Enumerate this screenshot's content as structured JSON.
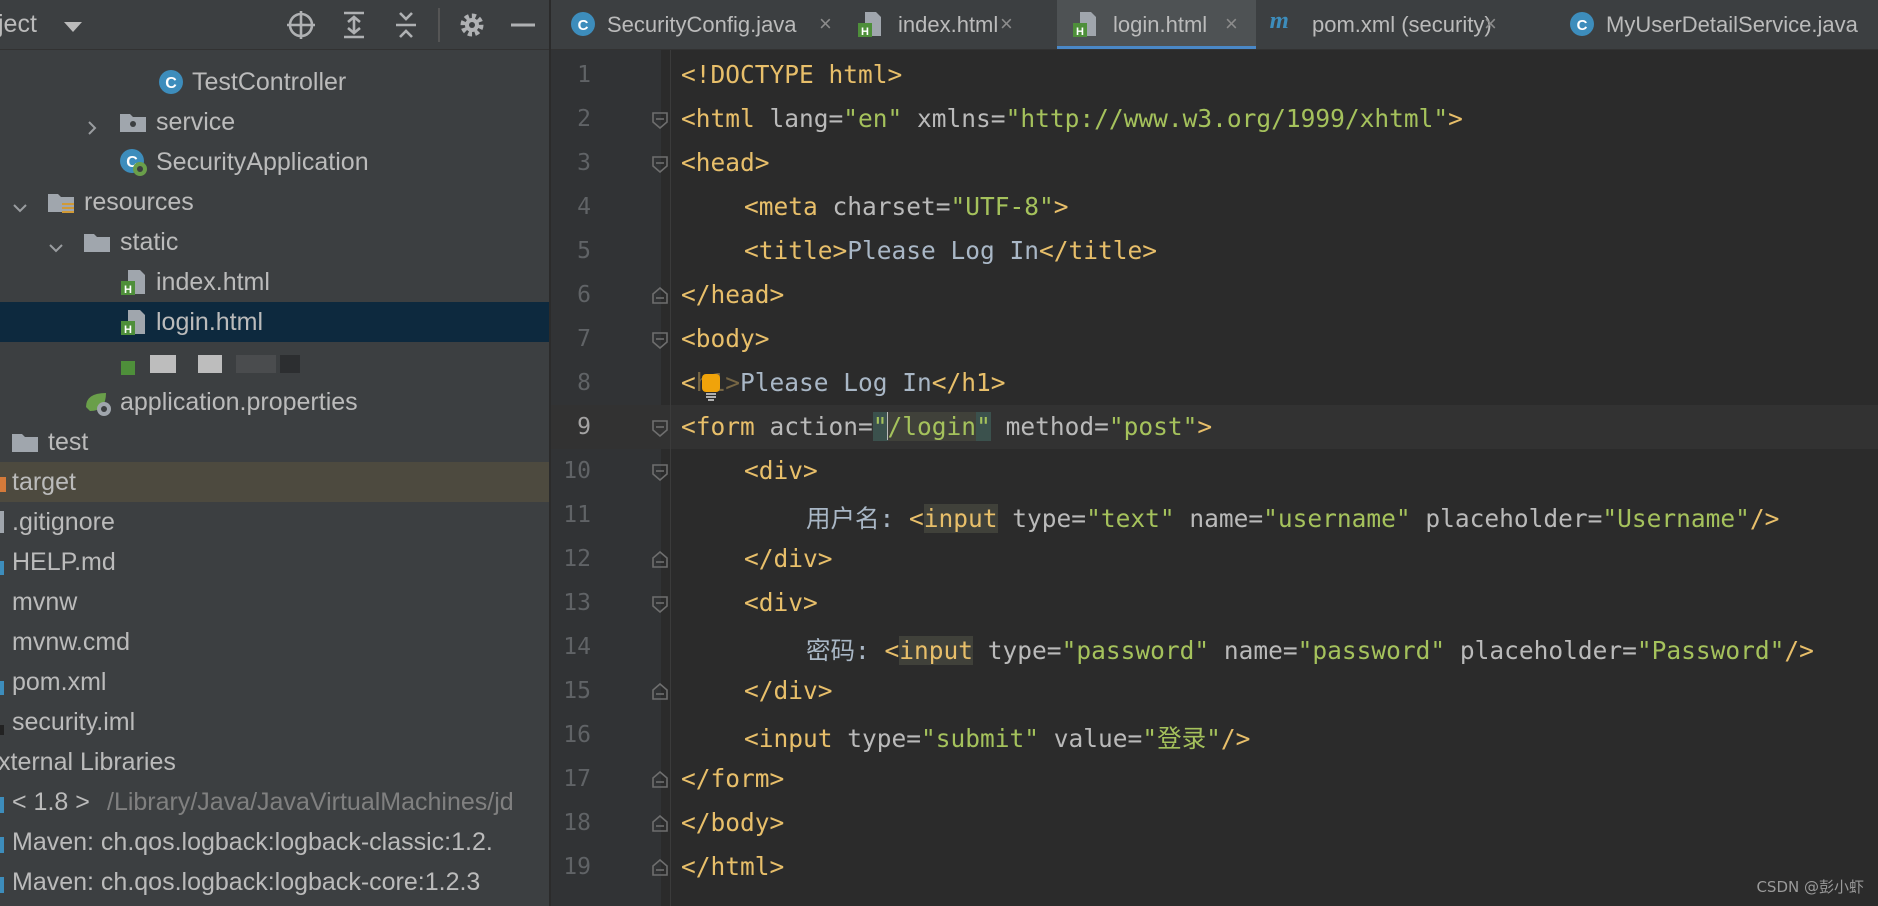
{
  "project_panel": {
    "title": "ject",
    "tree": [
      {
        "label": "TestController",
        "icon": "java-class-icon"
      },
      {
        "label": "service",
        "icon": "package-folder-icon"
      },
      {
        "label": "SecurityApplication",
        "icon": "spring-boot-app-icon"
      },
      {
        "label": "resources",
        "icon": "resources-folder-icon"
      },
      {
        "label": "static",
        "icon": "folder-icon"
      },
      {
        "label": "index.html",
        "icon": "html-file-icon"
      },
      {
        "label": "login.html",
        "icon": "html-file-icon"
      },
      {
        "label": "",
        "icon": "html-file-icon"
      },
      {
        "label": "application.properties",
        "icon": "spring-properties-icon"
      },
      {
        "label": "test",
        "icon": "folder-icon"
      },
      {
        "label": "target",
        "icon": "excluded-folder-icon"
      },
      {
        "label": ".gitignore",
        "icon": "text-file-icon"
      },
      {
        "label": "HELP.md",
        "icon": "markdown-file-icon"
      },
      {
        "label": "mvnw",
        "icon": "text-file-icon"
      },
      {
        "label": "mvnw.cmd",
        "icon": "text-file-icon"
      },
      {
        "label": "pom.xml",
        "icon": "maven-file-icon"
      },
      {
        "label": "security.iml",
        "icon": "iml-file-icon"
      },
      {
        "label": "xternal Libraries",
        "icon": "libraries-icon"
      },
      {
        "label": "< 1.8 >",
        "path": "/Library/Java/JavaVirtualMachines/jd",
        "icon": "jdk-icon"
      },
      {
        "label": "Maven: ch.qos.logback:logback-classic:1.2.",
        "icon": "library-jar-icon"
      },
      {
        "label": "Maven: ch.qos.logback:logback-core:1.2.3",
        "icon": "library-jar-icon"
      }
    ]
  },
  "tabs": [
    {
      "label": "SecurityConfig.java",
      "icon": "java-class-icon"
    },
    {
      "label": "index.html",
      "icon": "html-file-icon"
    },
    {
      "label": "login.html",
      "icon": "html-file-icon"
    },
    {
      "label": "pom.xml (security)",
      "icon": "maven-m-icon"
    },
    {
      "label": "MyUserDetailService.java",
      "icon": "java-class-icon"
    }
  ],
  "tab_close_glyph": "×",
  "editor": {
    "active_line": 9,
    "line_numbers": [
      "1",
      "2",
      "3",
      "4",
      "5",
      "6",
      "7",
      "8",
      "9",
      "10",
      "11",
      "12",
      "13",
      "14",
      "15",
      "16",
      "17",
      "18",
      "19"
    ],
    "code": {
      "l1": {
        "decl": "<!DOCTYPE html>"
      },
      "l2": {
        "open": "<html",
        "attr1": " lang=",
        "val1": "\"en\"",
        "attr2": " xmlns=",
        "val2": "\"http://www.w3.org/1999/xhtml\"",
        "close": ">"
      },
      "l3": {
        "tag": "<head>"
      },
      "l4": {
        "open": "<meta",
        "attr": " charset=",
        "val": "\"UTF-8\"",
        "close": ">"
      },
      "l5": {
        "open": "<title>",
        "text": "Please Log In",
        "close": "</title>"
      },
      "l6": {
        "tag": "</head>"
      },
      "l7": {
        "tag": "<body>"
      },
      "l8": {
        "open_a": "<",
        "open_b": "h1>",
        "text": "Please Log In",
        "close": "</h1>"
      },
      "l9": {
        "open": "<form",
        "attr1": " action=",
        "q1": "\"",
        "val1": "/login",
        "q2": "\"",
        "attr2": " method=",
        "val2": "\"post\"",
        "close": ">"
      },
      "l10": {
        "tag": "<div>"
      },
      "l11": {
        "label": "用户名: ",
        "lt": "<",
        "tag": "input",
        "attr1": " type=",
        "val1": "\"text\"",
        "attr2": " name=",
        "val2": "\"username\"",
        "attr3": " placeholder=",
        "val3": "\"Username\"",
        "close": "/>"
      },
      "l12": {
        "tag": "</div>"
      },
      "l13": {
        "tag": "<div>"
      },
      "l14": {
        "label": "密码: ",
        "lt": "<",
        "tag": "input",
        "attr1": " type=",
        "val1": "\"password\"",
        "attr2": " name=",
        "val2": "\"password\"",
        "attr3": " placeholder=",
        "val3": "\"Password\"",
        "close": "/>"
      },
      "l15": {
        "tag": "</div>"
      },
      "l16": {
        "open": "<input",
        "attr1": " type=",
        "val1": "\"submit\"",
        "attr2": " value=",
        "val2": "\"登录\"",
        "close": "/>"
      },
      "l17": {
        "tag": "</form>"
      },
      "l18": {
        "tag": "</body>"
      },
      "l19": {
        "tag": "</html>"
      }
    }
  },
  "watermark": "CSDN @彭小虾",
  "colors": {
    "background": "#2b2b2b",
    "panel": "#3c3f41",
    "tag": "#e8bf6a",
    "string": "#6a8759",
    "selection": "#0d293e",
    "tab_underline": "#4a88c7"
  }
}
